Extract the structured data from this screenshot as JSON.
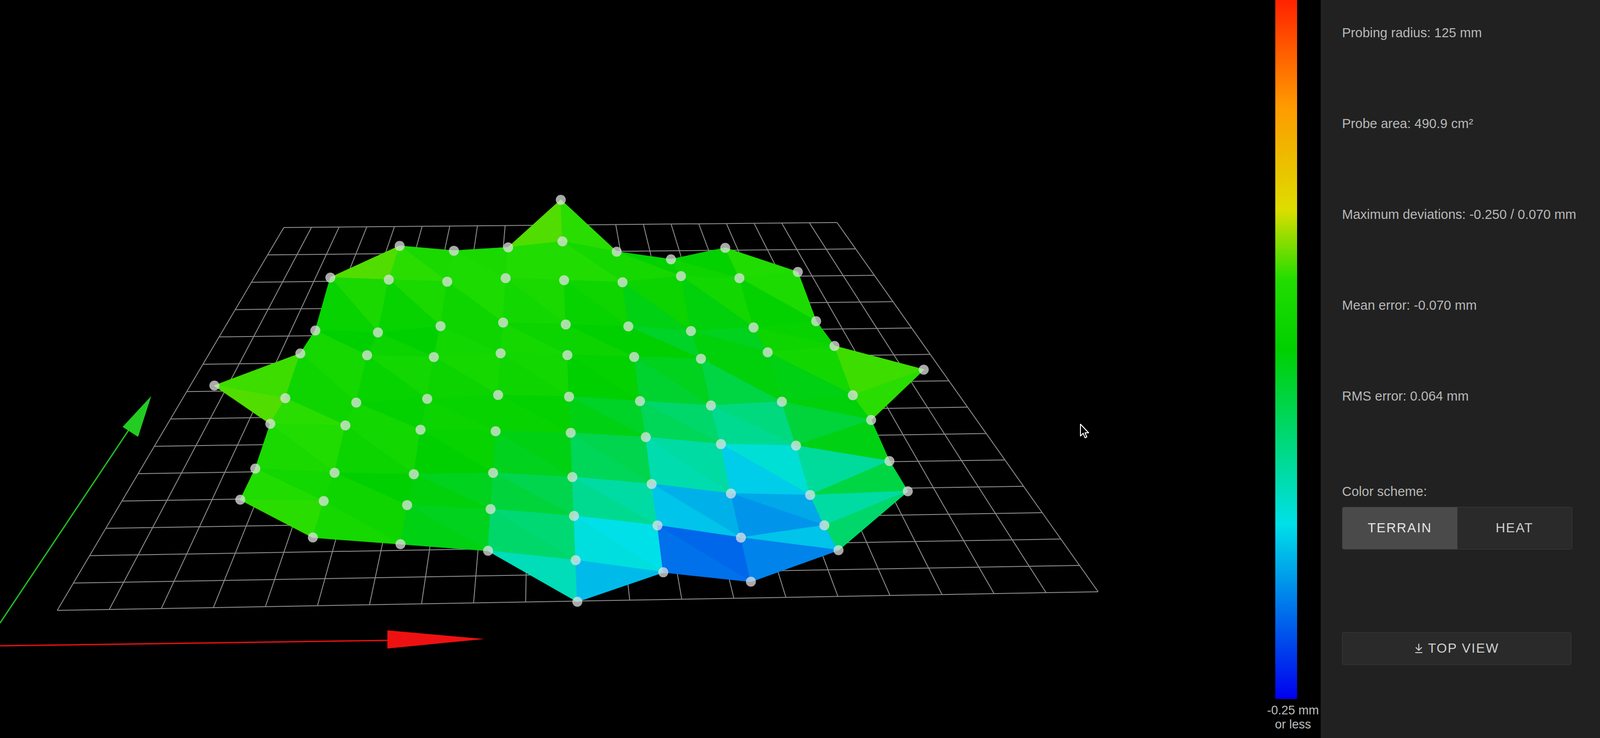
{
  "panel": {
    "stats": [
      "Probing radius: 125 mm",
      "Probe area: 490.9 cm²",
      "Maximum deviations: -0.250 / 0.070 mm",
      "Mean error: -0.070 mm",
      "RMS error: 0.064 mm"
    ],
    "color_scheme": {
      "label": "Color scheme:",
      "options": [
        {
          "label": "TERRAIN",
          "selected": true
        },
        {
          "label": "HEAT",
          "selected": false
        }
      ]
    },
    "top_view_button": {
      "label": "TOP VIEW"
    }
  },
  "color_scale": {
    "min_label": [
      "-0.25 mm",
      "or less"
    ],
    "range": [
      -0.25,
      0.07
    ]
  },
  "height_map": {
    "heights": [
      [
        null,
        null,
        null,
        null,
        null,
        -0.03,
        null,
        null,
        null,
        null,
        null
      ],
      [
        null,
        null,
        -0.06,
        -0.08,
        -0.07,
        -0.05,
        -0.09,
        -0.12,
        -0.08,
        null,
        null
      ],
      [
        null,
        -0.04,
        -0.05,
        -0.06,
        -0.05,
        -0.06,
        -0.07,
        -0.05,
        -0.06,
        -0.04,
        null
      ],
      [
        null,
        -0.1,
        -0.11,
        -0.09,
        -0.08,
        -0.09,
        -0.1,
        -0.12,
        -0.11,
        -0.09,
        null
      ],
      [
        null,
        -0.05,
        -0.06,
        -0.07,
        -0.06,
        -0.07,
        -0.08,
        -0.09,
        -0.07,
        -0.05,
        null
      ],
      [
        -0.03,
        -0.08,
        -0.1,
        -0.09,
        -0.08,
        -0.09,
        -0.11,
        -0.13,
        -0.12,
        -0.1,
        -0.01
      ],
      [
        null,
        -0.04,
        -0.05,
        -0.07,
        -0.08,
        -0.09,
        -0.11,
        -0.14,
        -0.15,
        -0.06,
        null
      ],
      [
        null,
        -0.07,
        -0.09,
        -0.1,
        -0.1,
        -0.12,
        -0.15,
        -0.19,
        -0.2,
        -0.08,
        null
      ],
      [
        null,
        -0.05,
        -0.06,
        -0.08,
        -0.1,
        -0.13,
        -0.17,
        -0.22,
        -0.18,
        -0.06,
        null
      ],
      [
        null,
        null,
        -0.06,
        -0.09,
        -0.12,
        -0.16,
        -0.21,
        -0.25,
        -0.14,
        null,
        null
      ],
      [
        null,
        null,
        null,
        null,
        null,
        -0.18,
        null,
        null,
        null,
        null,
        null
      ]
    ]
  }
}
